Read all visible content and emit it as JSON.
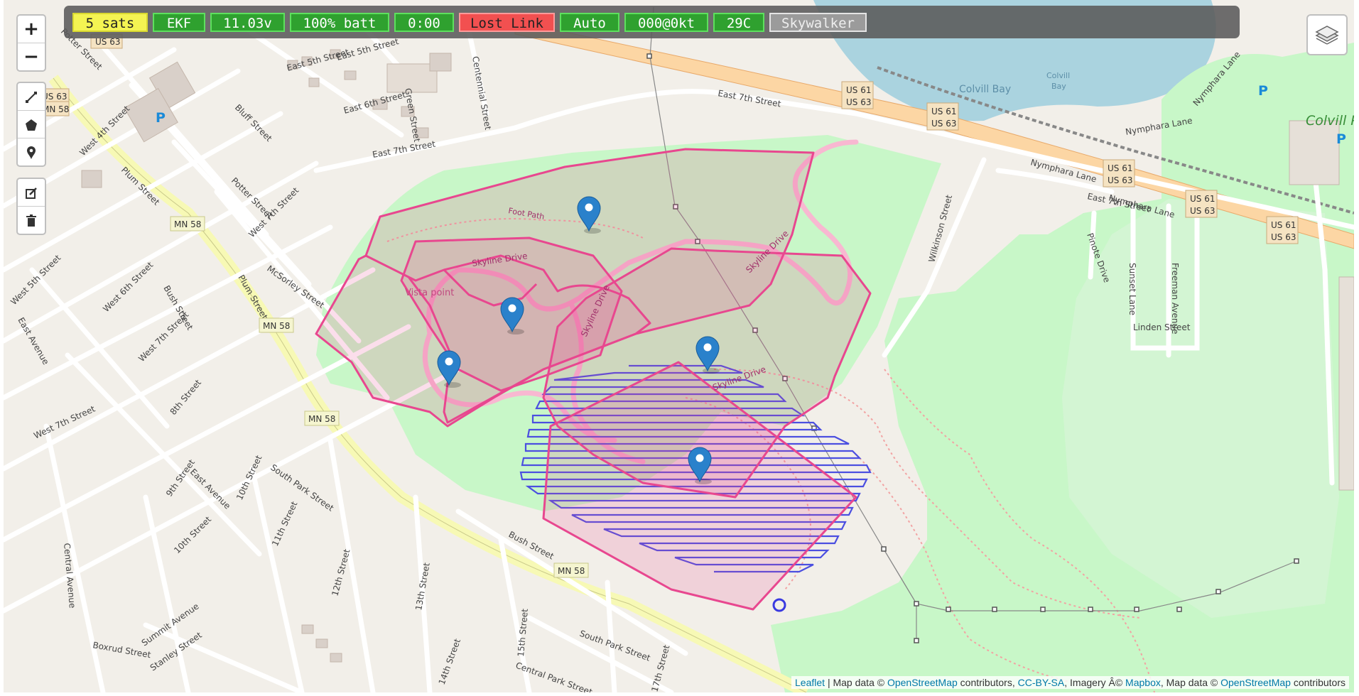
{
  "status_bar": {
    "sats": "5 sats",
    "ekf": "EKF",
    "voltage": "11.03v",
    "battery": "100% batt",
    "timer": "0:00",
    "link": "Lost Link",
    "mode": "Auto",
    "speed": "000@0kt",
    "temperature": "29C",
    "vehicle": "Skywalker"
  },
  "controls": {
    "zoom_in": "+",
    "zoom_out": "−"
  },
  "map_labels": {
    "streets": {
      "east_5th_1": "East 5th Street",
      "east_5th_2": "East 5th Street",
      "east_6th": "East 6th Street",
      "east_7th_1": "East 7th Street",
      "east_7th_2": "East 7th Street",
      "east_7th_3": "East 7th Street",
      "centennial": "Centennial Street",
      "green": "Green Street",
      "potter_1": "Potter Street",
      "potter_2": "Potter Street",
      "bluff": "Bluff Street",
      "west_4th": "West 4th Street",
      "west_5th": "West 5th Street",
      "west_6th": "West 6th Street",
      "west_7th_1": "West 7th Street",
      "west_7th_2": "West 7th Street",
      "west_7th_3": "West 7th Street",
      "plum_1": "Plum Street",
      "plum_2": "Plum Street",
      "mcsorley": "McSorley Street",
      "bush_1": "Bush Street",
      "bush_2": "Bush Street",
      "east_ave": "East Avenue",
      "east_ave_2": "East Avenue",
      "eighth": "8th Street",
      "ninth": "9th Street",
      "tenth_1": "10th Street",
      "tenth_2": "10th Street",
      "eleventh": "11th Street",
      "twelfth": "12th Street",
      "thirteenth": "13th Street",
      "fourteenth": "14th Street",
      "fifteenth": "15th Street",
      "seventeenth": "17th Street",
      "south_park_1": "South Park Street",
      "south_park_2": "South Park Street",
      "central_park": "Central Park Street",
      "central_ave": "Central Avenue",
      "boxrud": "Boxrud Street",
      "summit": "Summit Avenue",
      "stanley": "Stanley Street",
      "wilkinson": "Wilkinson Street",
      "pinote": "Pinote Drive",
      "sunset": "Sunset Lane",
      "freeman": "Freeman Avenue",
      "linden": "Linden Street",
      "nymphara_1": "Nymphara Lane",
      "nymphara_2": "Nymphara Lane",
      "nymphara_3": "Nymphara Lane",
      "nymphara_4": "Nymphara Lane",
      "skyline_1": "Skyline Drive",
      "skyline_2": "Skyline Drive",
      "skyline_3": "Skyline Drive",
      "skyline_4": "Skyline Drive",
      "foot_path": "Foot Path",
      "vista_point": "Vista point"
    },
    "places": {
      "colvill_bay": "Colvill Bay",
      "colvill_bay_small_1": "Colvill",
      "colvill_bay_small_2": "Bay",
      "colvill_park": "Colvill Pa",
      "parking": "P"
    },
    "shields": {
      "us61": "US 61",
      "us63": "US 63",
      "mn58": "MN 58"
    }
  },
  "attribution": {
    "leaflet": "Leaflet",
    "map_data": " | Map data © ",
    "osm": "OpenStreetMap",
    "contributors": " contributors, ",
    "ccbysa": "CC-BY-SA",
    "imagery": ", Imagery Â© ",
    "mapbox": "Mapbox",
    "map_data2": ", Map data © ",
    "osm2": "OpenStreetMap",
    "contributors2": " contributors"
  },
  "colors": {
    "geofence": "#e8478f",
    "survey": "#4b4fe0",
    "park": "#c8f7c8",
    "highway": "#fdd3a0"
  },
  "icons": [
    "zoom-in-icon",
    "zoom-out-icon",
    "polyline-icon",
    "polygon-icon",
    "marker-icon",
    "edit-icon",
    "trash-icon",
    "layers-icon",
    "map-pin-icon"
  ]
}
